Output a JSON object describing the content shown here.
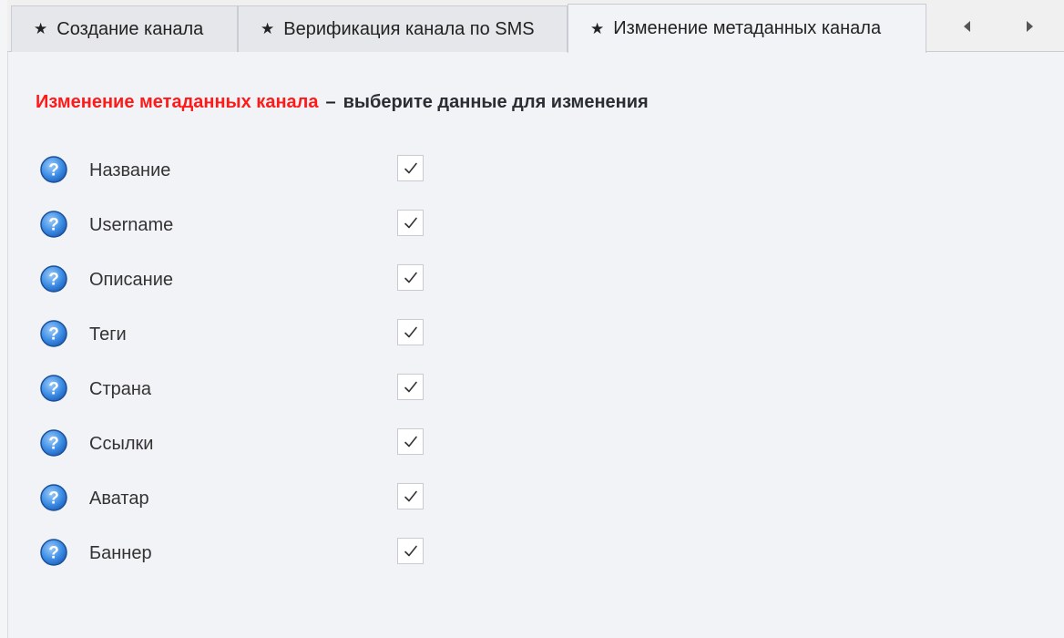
{
  "tabs": [
    {
      "label": "Создание канала",
      "active": false
    },
    {
      "label": "Верификация канала по SMS",
      "active": false
    },
    {
      "label": "Изменение метаданных канала",
      "active": true
    }
  ],
  "tab_star": "★",
  "heading": {
    "title": "Изменение метаданных канала",
    "dash": "–",
    "subtitle": "выберите данные для изменения"
  },
  "options": [
    {
      "label": "Название",
      "checked": true
    },
    {
      "label": "Username",
      "checked": true
    },
    {
      "label": "Описание",
      "checked": true
    },
    {
      "label": "Теги",
      "checked": true
    },
    {
      "label": "Страна",
      "checked": true
    },
    {
      "label": "Ссылки",
      "checked": true
    },
    {
      "label": "Аватар",
      "checked": true
    },
    {
      "label": "Баннер",
      "checked": true
    }
  ],
  "icons": {
    "help": "question-circle-icon",
    "check": "checkmark-icon",
    "prev": "arrow-left-icon",
    "next": "arrow-right-icon"
  },
  "colors": {
    "accent_red": "#ff1a1a",
    "help_blue": "#3d8ee6",
    "panel_bg": "#f2f3f6"
  }
}
